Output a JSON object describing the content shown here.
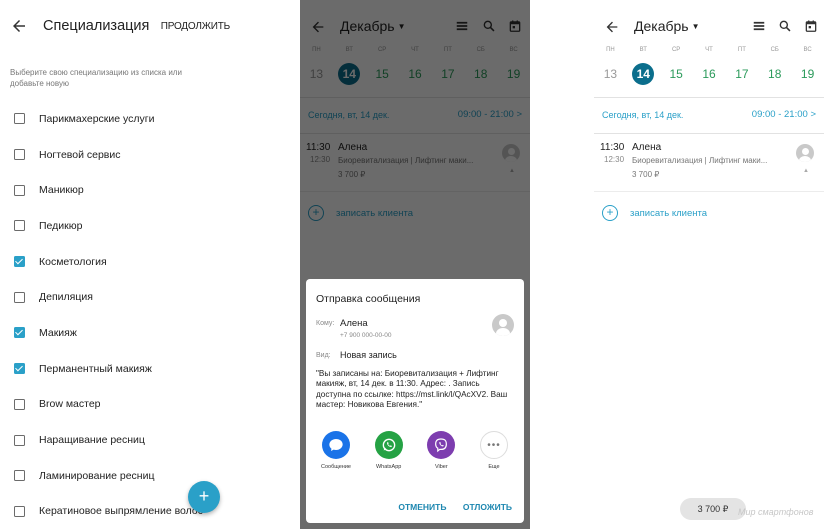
{
  "specialization": {
    "title": "Специализация",
    "continue_label": "ПРОДОЛЖИТЬ",
    "hint": "Выберите свою специализацию из списка или добавьте новую",
    "items": [
      {
        "label": "Парикмахерские услуги",
        "checked": false
      },
      {
        "label": "Ногтевой сервис",
        "checked": false
      },
      {
        "label": "Маникюр",
        "checked": false
      },
      {
        "label": "Педикюр",
        "checked": false
      },
      {
        "label": "Косметология",
        "checked": true
      },
      {
        "label": "Депиляция",
        "checked": false
      },
      {
        "label": "Макияж",
        "checked": true
      },
      {
        "label": "Перманентный макияж",
        "checked": true
      },
      {
        "label": "Brow мастер",
        "checked": false
      },
      {
        "label": "Наращивание ресниц",
        "checked": false
      },
      {
        "label": "Ламинирование ресниц",
        "checked": false
      },
      {
        "label": "Кератиновое выпрямление волос",
        "checked": false
      }
    ],
    "fab_label": "+"
  },
  "calendar": {
    "month": "Декабрь",
    "weekdays": [
      "ПН",
      "ВТ",
      "СР",
      "ЧТ",
      "ПТ",
      "СБ",
      "ВС"
    ],
    "dates": [
      "13",
      "14",
      "15",
      "16",
      "17",
      "18",
      "19"
    ],
    "selected_index": 1,
    "today_label": "Сегодня, вт, 14 дек.",
    "hours": "09:00 - 21:00",
    "appointment": {
      "time_start": "11:30",
      "time_end": "12:30",
      "client": "Алена",
      "service": "Биоревитализация | Лифтинг маки...",
      "price": "3 700 ₽"
    },
    "add_client_label": "записать клиента",
    "colors": {
      "accent": "#2aa0c8",
      "selected_day": "#0b6e8c",
      "future_day": "#2a9a5a"
    }
  },
  "dialog": {
    "title": "Отправка сообщения",
    "to_key": "Кому:",
    "to_name": "Алена",
    "to_phone": "+7 900 000-00-00",
    "type_key": "Вид:",
    "type_value": "Новая запись",
    "message": "\"Вы записаны на: Биоревитализация + Лифтинг макияж, вт, 14 дек. в 11:30. Адрес: . Запись доступна по ссылке: https://mst.link/l/QAcXV2. Ваш мастер: Новикова Евгения.\"",
    "apps": [
      {
        "label": "Сообщение",
        "icon": "chat-bubble-icon",
        "color": "#1a73e8"
      },
      {
        "label": "WhatsApp",
        "icon": "whatsapp-icon",
        "color": "#25a244"
      },
      {
        "label": "Viber",
        "icon": "viber-icon",
        "color": "#7d3daf"
      },
      {
        "label": "Еще",
        "icon": "more-icon",
        "color": "#ffffff"
      }
    ],
    "cancel_label": "ОТМЕНИТЬ",
    "postpone_label": "ОТЛОЖИТЬ"
  },
  "screen3": {
    "chip_label": "3 700 ₽",
    "watermark": "Мир смартфонов"
  }
}
